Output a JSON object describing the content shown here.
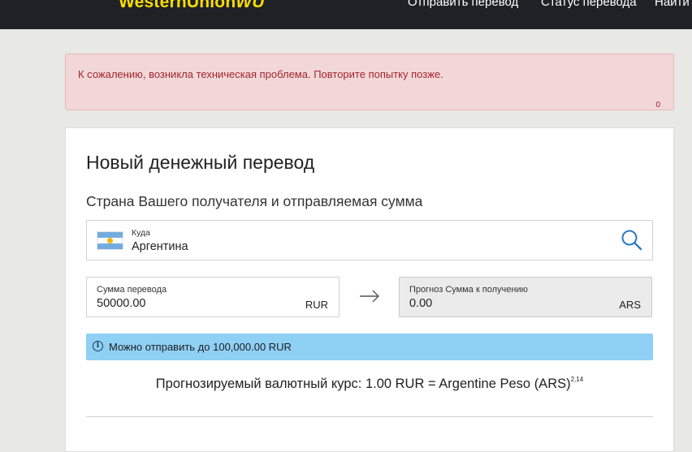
{
  "header": {
    "logo_text": "WesternUnion",
    "logo_mark": "WU",
    "nav": [
      "Отправить перевод",
      "Статус перевода",
      "Найти"
    ]
  },
  "alert": {
    "message": "К сожалению, возникла техническая проблема. Повторите попытку позже.",
    "code": "0"
  },
  "form": {
    "title": "Новый денежный перевод",
    "subtitle": "Страна Вашего получателя и отправляемая сумма",
    "destination": {
      "label": "Куда",
      "value": "Аргентина",
      "flag_icon": "argentina-flag-icon",
      "search_icon": "search-icon"
    },
    "send_amount": {
      "label": "Сумма перевода",
      "value": "50000.00",
      "currency": "RUR"
    },
    "arrow_icon": "arrow-right-icon",
    "receive_amount": {
      "label": "Прогноз Сумма к получению",
      "value": "0.00",
      "currency": "ARS"
    },
    "info": {
      "icon": "info-icon",
      "text": "Можно отправить до 100,000.00 RUR"
    },
    "rate": {
      "text": "Прогнозируемый валютный курс: 1.00 RUR = Argentine Peso (ARS)",
      "footnote": "2,14"
    }
  },
  "colors": {
    "header_bg": "#1e2227",
    "brand_yellow": "#ffdd00",
    "alert_bg": "#f2d7d9",
    "alert_text": "#a3262c",
    "info_bg": "#8fd0f5"
  }
}
